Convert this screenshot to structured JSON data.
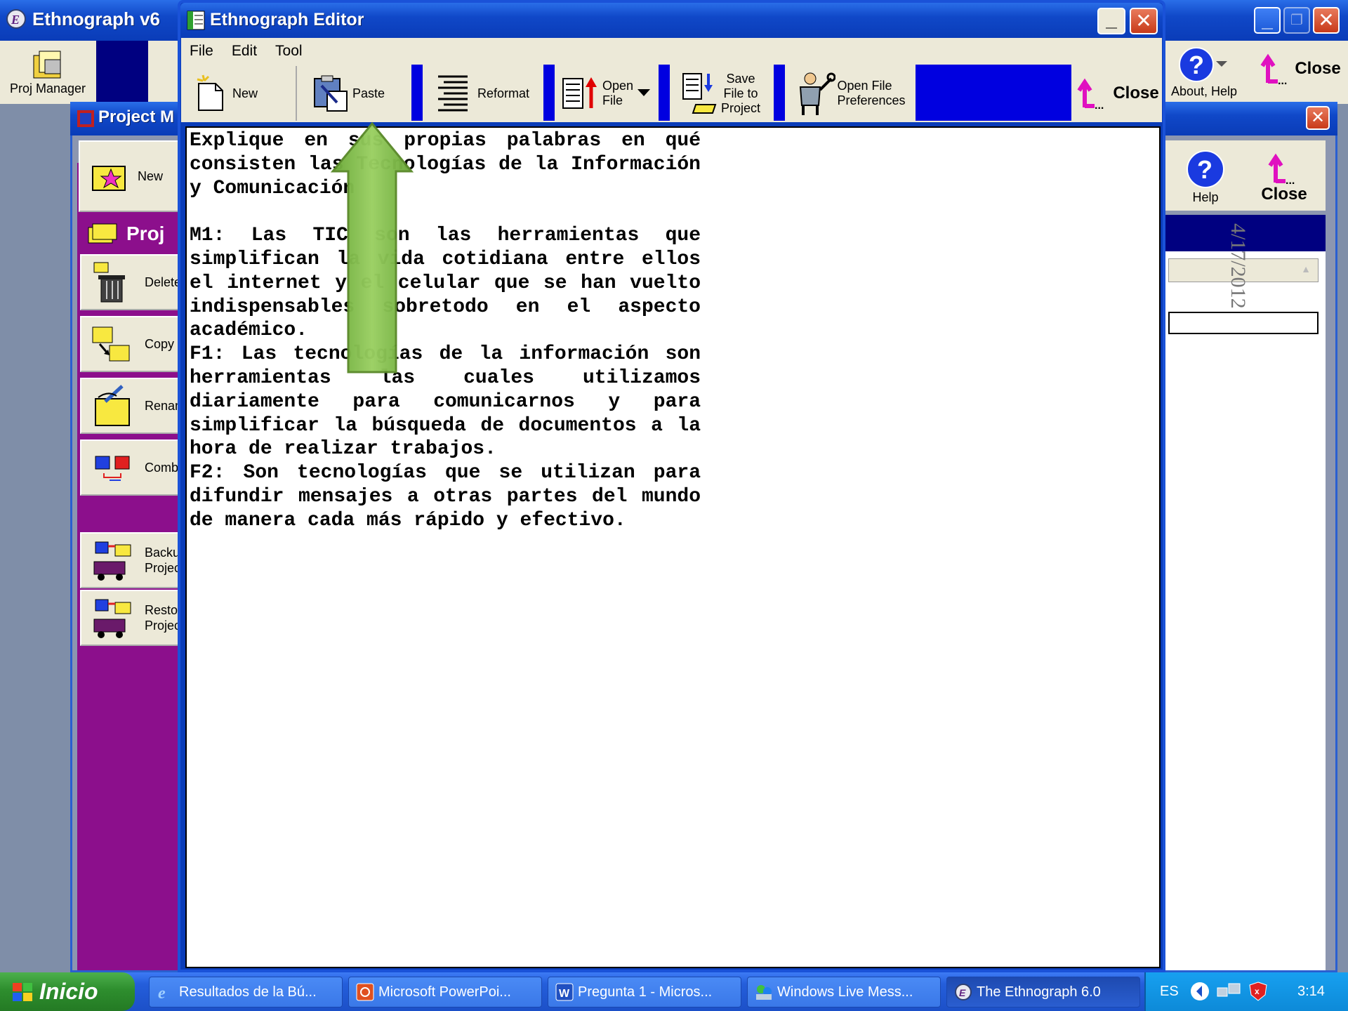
{
  "main_window": {
    "title": "Ethnograph v6",
    "toolbar": {
      "proj_manager": "Proj Manager",
      "about_help": "About, Help",
      "close": "Close"
    }
  },
  "project_manager": {
    "title": "Project M",
    "new": "New",
    "section_title": "Proj",
    "delete": "Delete",
    "copy": "Copy",
    "rename": "Renam",
    "combine": "Combi",
    "backup_line1": "Backup",
    "backup_line2": "Projec",
    "restore_line1": "Restor",
    "restore_line2": "Projec",
    "help": "Help",
    "close": "Close",
    "date": "4/17/2012"
  },
  "editor": {
    "title": "Ethnograph Editor",
    "menu": [
      "File",
      "Edit",
      "Tool"
    ],
    "toolbar": {
      "new": "New",
      "paste": "Paste",
      "reformat": "Reformat",
      "open_file_line1": "Open",
      "open_file_line2": "File",
      "save_line1": "Save",
      "save_line2": "File to",
      "save_line3": "Project",
      "prefs_line1": "Open File",
      "prefs_line2": "Preferences",
      "close": "Close"
    },
    "content": "Explique en sus propias palabras en qué consisten las Tecnologías de la Información y Comunicación\n\nM1: Las TIC son las herramientas que simplifican la vida cotidiana entre ellos el internet y el celular que se han vuelto indispensables sobretodo en el aspecto académico.\nF1: Las tecnologías de la información son herramientas las cuales utilizamos diariamente para comunicarnos y para simplificar la búsqueda de documentos a la hora de realizar trabajos.\nF2: Son tecnologías que se utilizan para difundir mensajes a otras partes del mundo de manera cada más rápido y efectivo."
  },
  "taskbar": {
    "start": "Inicio",
    "tasks": [
      "Resultados de la Bú...",
      "Microsoft PowerPoi...",
      "Pregunta 1 - Micros...",
      "Windows Live Mess...",
      "The Ethnograph 6.0"
    ],
    "language": "ES",
    "clock": "3:14"
  },
  "colors": {
    "xp_blue": "#0a3cb8",
    "sidebar_purple": "#8c0f8c",
    "toolbar_bg": "#ece9d8",
    "navy": "#000080",
    "arrow_green": "#8cc850"
  }
}
